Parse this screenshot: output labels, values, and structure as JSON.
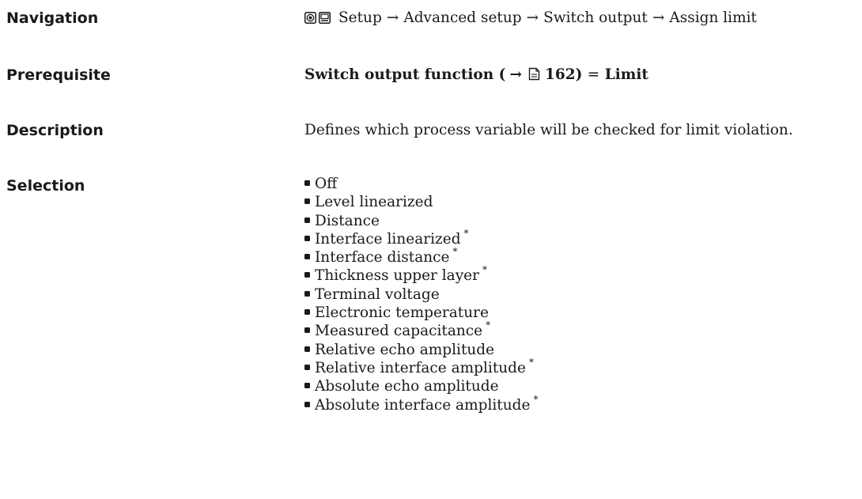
{
  "navigation": {
    "label": "Navigation",
    "icons": [
      "expert-menu-icon",
      "display-menu-icon"
    ],
    "path": [
      "Setup",
      "Advanced setup",
      "Switch output",
      "Assign limit"
    ],
    "separator": "→"
  },
  "prerequisite": {
    "label": "Prerequisite",
    "parameter": "Switch output function",
    "open_paren": "(",
    "arrow": "→",
    "page_ref": "162",
    "close_paren": ")",
    "equals": "=",
    "value": "Limit"
  },
  "description": {
    "label": "Description",
    "text": "Defines which process variable will be checked for limit violation."
  },
  "selection": {
    "label": "Selection",
    "footnote_marker": "*",
    "items": [
      {
        "text": "Off",
        "footnote": false
      },
      {
        "text": "Level linearized",
        "footnote": false
      },
      {
        "text": "Distance",
        "footnote": false
      },
      {
        "text": "Interface linearized",
        "footnote": true
      },
      {
        "text": "Interface distance",
        "footnote": true
      },
      {
        "text": "Thickness upper layer",
        "footnote": true
      },
      {
        "text": "Terminal voltage",
        "footnote": false
      },
      {
        "text": "Electronic temperature",
        "footnote": false
      },
      {
        "text": "Measured capacitance",
        "footnote": true
      },
      {
        "text": "Relative echo amplitude",
        "footnote": false
      },
      {
        "text": "Relative interface amplitude",
        "footnote": true
      },
      {
        "text": "Absolute echo amplitude",
        "footnote": false
      },
      {
        "text": "Absolute interface amplitude",
        "footnote": true
      }
    ]
  }
}
